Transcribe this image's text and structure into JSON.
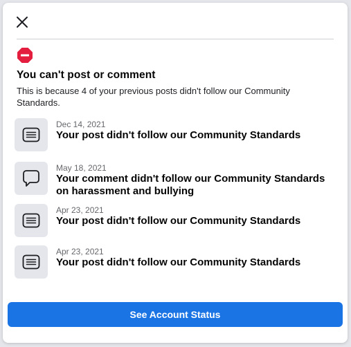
{
  "dialog": {
    "title": "You can't post or comment",
    "subtitle": "This is because 4 of your previous posts didn't follow our Community Standards.",
    "items": [
      {
        "icon": "post-icon",
        "date": "Dec 14, 2021",
        "text": "Your post didn't follow our Community Standards"
      },
      {
        "icon": "comment-icon",
        "date": "May 18, 2021",
        "text": "Your comment didn't follow our Community Standards on harassment and bullying"
      },
      {
        "icon": "post-icon",
        "date": "Apr 23, 2021",
        "text": "Your post didn't follow our Community Standards"
      },
      {
        "icon": "post-icon",
        "date": "Apr 23, 2021",
        "text": "Your post didn't follow our Community Standards"
      }
    ],
    "button_label": "See Account Status"
  },
  "colors": {
    "accent": "#1b74e4",
    "stop_icon": "#e41e3f",
    "icon_box_bg": "#e4e6eb"
  }
}
